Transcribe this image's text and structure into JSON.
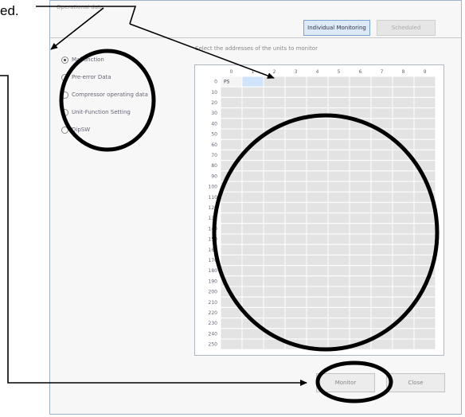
{
  "caption": "ed.",
  "window": {
    "title": "Operational data",
    "tabs": [
      {
        "label": "Individual Monitoring",
        "active": true
      },
      {
        "label": "Scheduled",
        "active": false
      }
    ]
  },
  "options": {
    "items": [
      {
        "label": "Malfunction",
        "selected": true
      },
      {
        "label": "Pre-error Data",
        "selected": false
      },
      {
        "label": "Compressor operating data",
        "selected": false
      },
      {
        "label": "Unit-Function Setting",
        "selected": false
      },
      {
        "label": "DipSW",
        "selected": false
      }
    ]
  },
  "grid": {
    "instruction": "Select the addresses of the units to monitor",
    "column_headers": [
      "0",
      "1",
      "2",
      "3",
      "4",
      "5",
      "6",
      "7",
      "8",
      "9"
    ],
    "row_headers": [
      "0",
      "10",
      "20",
      "30",
      "40",
      "50",
      "60",
      "70",
      "80",
      "90",
      "100",
      "110",
      "120",
      "130",
      "140",
      "150",
      "160",
      "170",
      "180",
      "190",
      "200",
      "210",
      "220",
      "230",
      "240",
      "250"
    ],
    "selected_cell_text": "PS"
  },
  "buttons": {
    "monitor": "Monitor",
    "close": "Close"
  },
  "colors": {
    "highlight_cell": "#cfe3fa",
    "annotation": "#000000"
  }
}
